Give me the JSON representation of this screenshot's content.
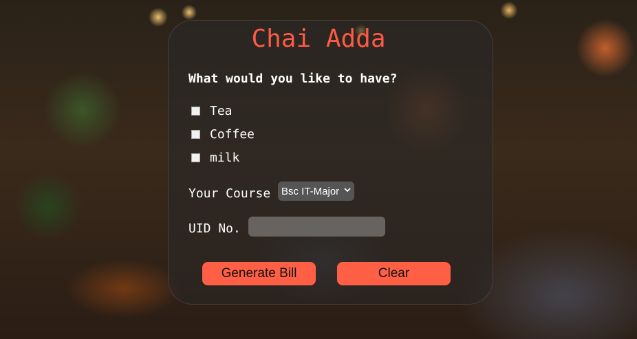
{
  "title": "Chai Adda",
  "question": "What would you like to have?",
  "options": [
    {
      "label": "Tea",
      "checked": false
    },
    {
      "label": "Coffee",
      "checked": false
    },
    {
      "label": "milk",
      "checked": false
    }
  ],
  "course": {
    "label": "Your Course",
    "selected": "Bsc IT-Major"
  },
  "uid": {
    "label": "UID No.",
    "value": ""
  },
  "buttons": {
    "generate": "Generate Bill",
    "clear": "Clear"
  },
  "colors": {
    "accent": "#ff5f45",
    "title": "#ff5a45"
  }
}
